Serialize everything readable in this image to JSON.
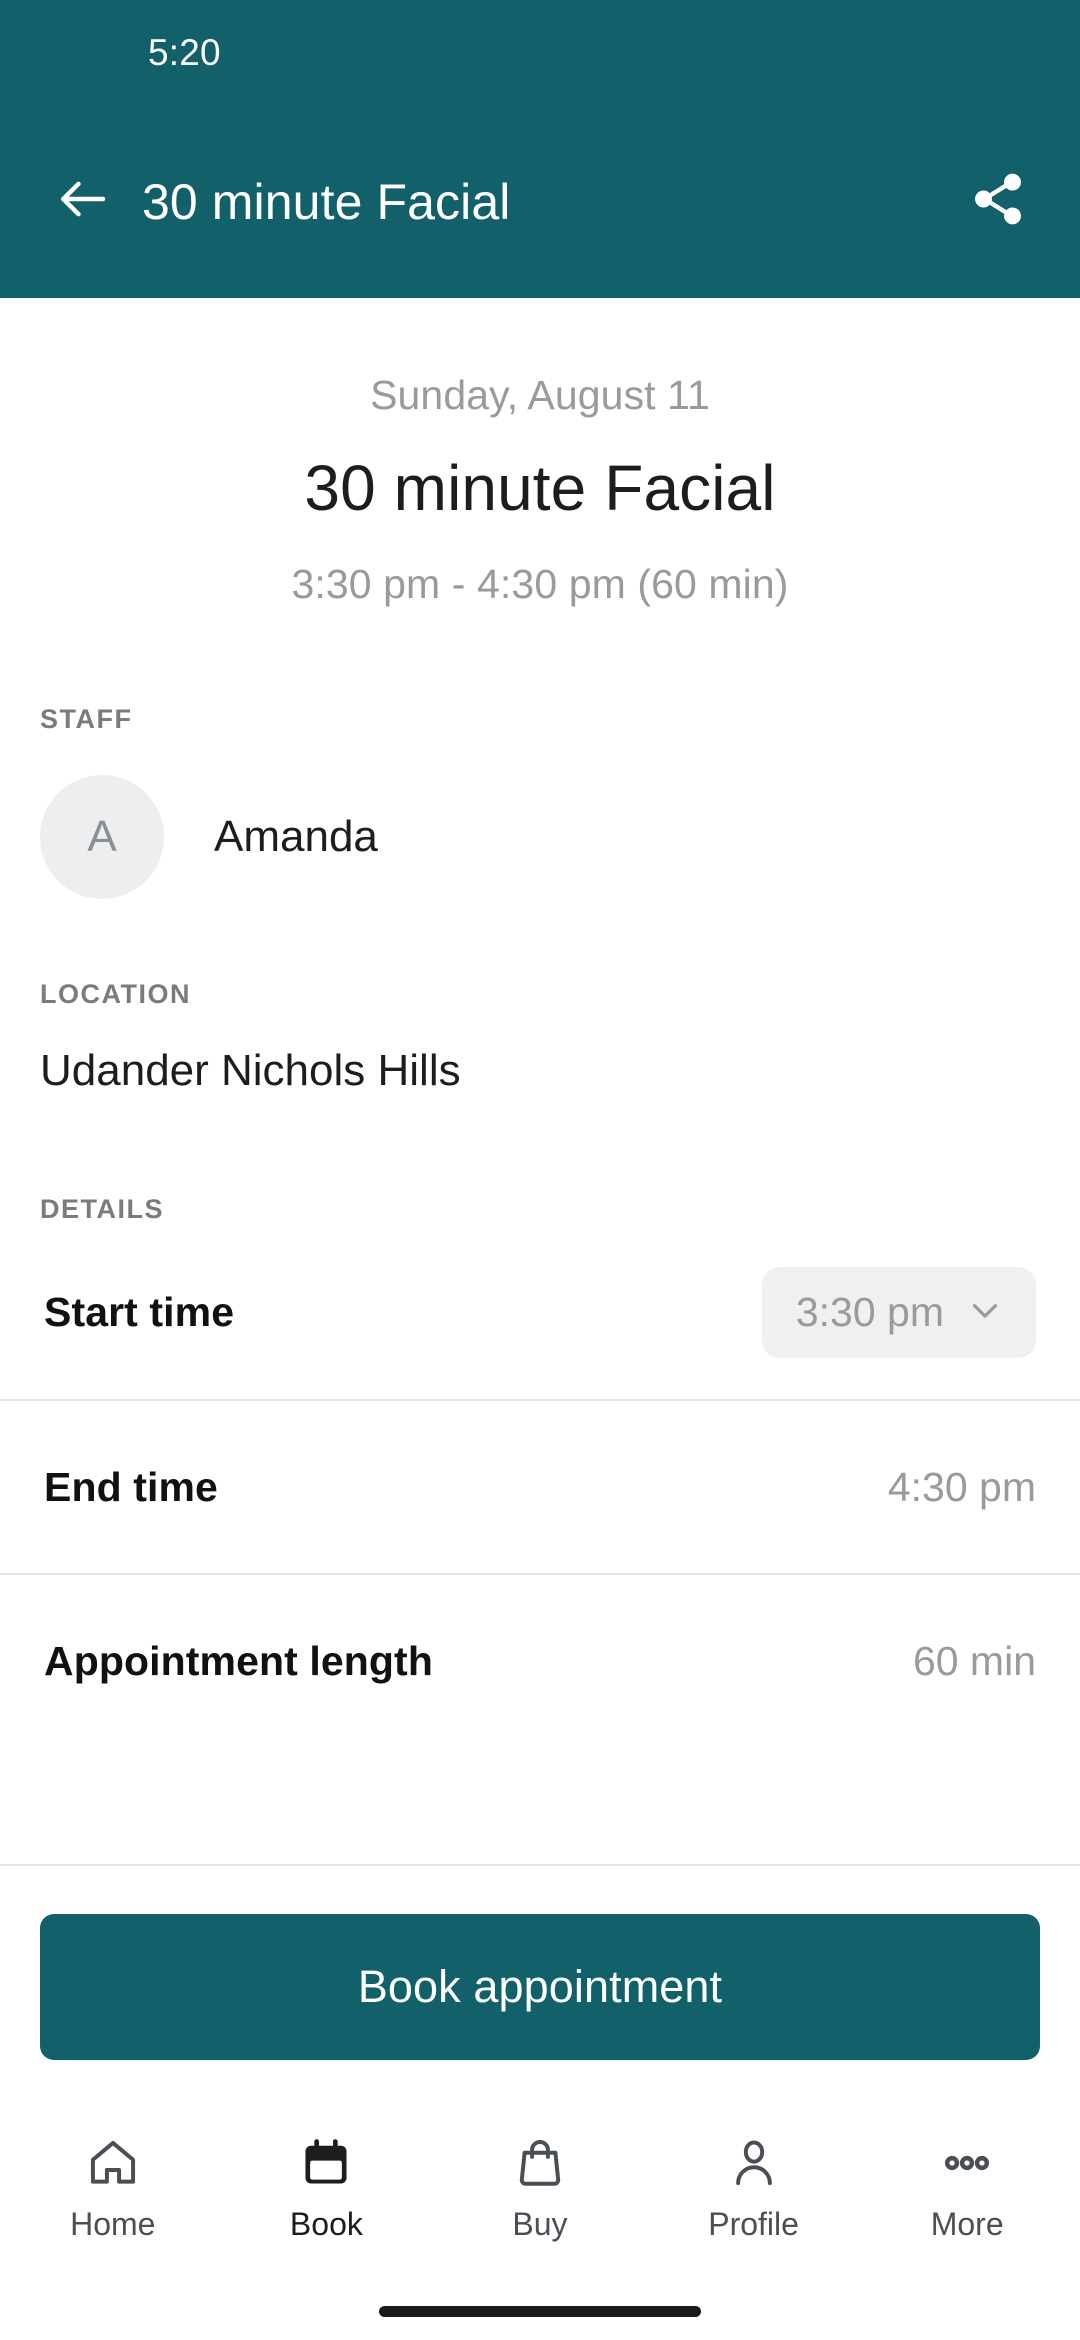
{
  "status_bar": {
    "clock": "5:20"
  },
  "app_bar": {
    "title": "30 minute Facial",
    "back_icon": "arrow-left-icon",
    "share_icon": "share-icon",
    "background_color": "#11606a",
    "text_color": "#ffffff"
  },
  "hero": {
    "date": "Sunday, August 11",
    "title": "30 minute Facial",
    "time_range": "3:30 pm - 4:30 pm (60 min)"
  },
  "staff": {
    "label": "STAFF",
    "avatar_initial": "A",
    "name": "Amanda"
  },
  "location": {
    "label": "LOCATION",
    "value": "Udander Nichols Hills"
  },
  "details": {
    "label": "DETAILS",
    "rows": [
      {
        "key": "Start time",
        "value": "3:30 pm",
        "type": "dropdown",
        "chevron_icon": "chevron-down-icon"
      },
      {
        "key": "End time",
        "value": "4:30 pm",
        "type": "text"
      },
      {
        "key": "Appointment length",
        "value": "60 min",
        "type": "text"
      }
    ]
  },
  "cta": {
    "book_label": "Book appointment",
    "color": "#11606a"
  },
  "bottom_nav": {
    "items": [
      {
        "label": "Home",
        "icon": "home-icon",
        "active": false
      },
      {
        "label": "Book",
        "icon": "calendar-icon",
        "active": true
      },
      {
        "label": "Buy",
        "icon": "shopping-bag-icon",
        "active": false
      },
      {
        "label": "Profile",
        "icon": "person-icon",
        "active": false
      },
      {
        "label": "More",
        "icon": "ellipsis-icon",
        "active": false
      }
    ]
  }
}
